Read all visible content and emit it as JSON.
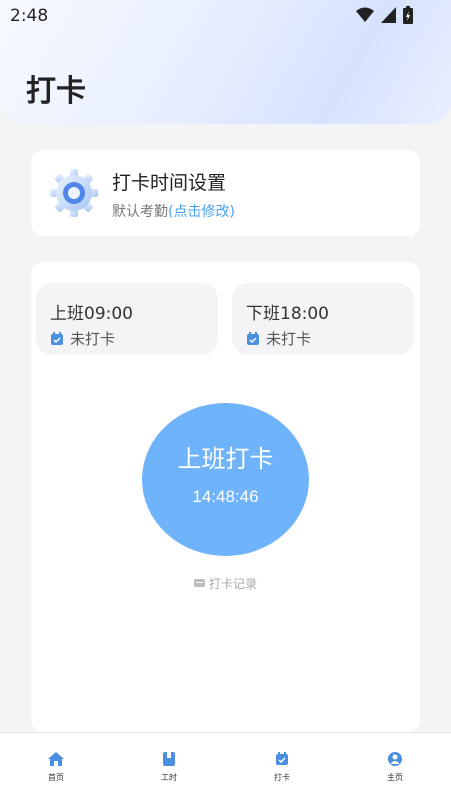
{
  "status_bar": {
    "time": "2:48",
    "icons": [
      "wifi-icon",
      "signal-icon",
      "battery-icon"
    ]
  },
  "header": {
    "title": "打卡"
  },
  "settings_card": {
    "title": "打卡时间设置",
    "subtitle_prefix": "默认考勤",
    "subtitle_link": "(点击修改)"
  },
  "shifts": [
    {
      "time": "上班09:00",
      "status": "未打卡"
    },
    {
      "time": "下班18:00",
      "status": "未打卡"
    }
  ],
  "punch": {
    "label": "上班打卡",
    "clock": "14:48:46"
  },
  "record": {
    "label": "打卡记录"
  },
  "tabbar": {
    "items": [
      {
        "label": "首页",
        "icon": "home-icon"
      },
      {
        "label": "工时",
        "icon": "book-icon"
      },
      {
        "label": "打卡",
        "icon": "calendar-check-icon"
      },
      {
        "label": "主页",
        "icon": "user-icon"
      }
    ]
  },
  "colors": {
    "accent": "#6fb3fb",
    "link": "#4aa3f0",
    "tab_icon": "#4a8fe0"
  }
}
